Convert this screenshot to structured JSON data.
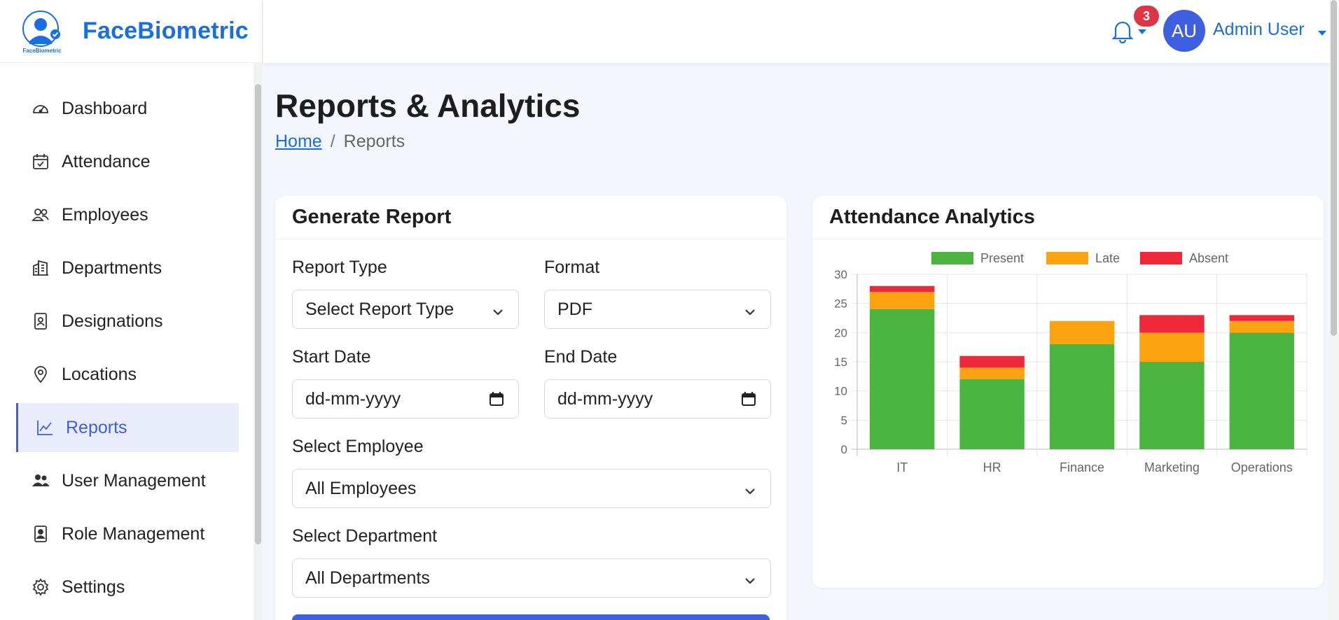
{
  "brand": {
    "name": "FaceBiometric",
    "logo_text": "FaceBiometric"
  },
  "sidebar": {
    "items": [
      {
        "label": "Dashboard",
        "icon": "gauge-icon"
      },
      {
        "label": "Attendance",
        "icon": "calendar-check-icon"
      },
      {
        "label": "Employees",
        "icon": "users-icon"
      },
      {
        "label": "Departments",
        "icon": "building-icon"
      },
      {
        "label": "Designations",
        "icon": "id-badge-icon"
      },
      {
        "label": "Locations",
        "icon": "map-pin-icon"
      },
      {
        "label": "Reports",
        "icon": "chart-line-icon",
        "active": true
      },
      {
        "label": "User Management",
        "icon": "user-group-icon"
      },
      {
        "label": "Role Management",
        "icon": "id-card-icon"
      },
      {
        "label": "Settings",
        "icon": "gear-icon"
      }
    ]
  },
  "header": {
    "notifications_count": "3",
    "avatar_initials": "AU",
    "user_name": "Admin User"
  },
  "page": {
    "title": "Reports & Analytics",
    "breadcrumb_home": "Home",
    "breadcrumb_sep": "/",
    "breadcrumb_current": "Reports"
  },
  "report_form": {
    "title": "Generate Report",
    "report_type_label": "Report Type",
    "report_type_value": "Select Report Type",
    "format_label": "Format",
    "format_value": "PDF",
    "start_date_label": "Start Date",
    "start_date_placeholder": "dd-mm-yyyy",
    "end_date_label": "End Date",
    "end_date_placeholder": "dd-mm-yyyy",
    "employee_label": "Select Employee",
    "employee_value": "All Employees",
    "department_label": "Select Department",
    "department_value": "All Departments"
  },
  "analytics": {
    "title": "Attendance Analytics"
  },
  "colors": {
    "present": "#4cb53f",
    "late": "#fca311",
    "absent": "#ed2939",
    "accent": "#3d5fe0"
  },
  "chart_data": {
    "type": "bar",
    "stacked": true,
    "categories": [
      "IT",
      "HR",
      "Finance",
      "Marketing",
      "Operations"
    ],
    "series": [
      {
        "name": "Present",
        "values": [
          24,
          12,
          18,
          15,
          20
        ]
      },
      {
        "name": "Late",
        "values": [
          3,
          2,
          4,
          5,
          2
        ]
      },
      {
        "name": "Absent",
        "values": [
          1,
          2,
          0,
          3,
          1
        ]
      }
    ],
    "ylim": [
      0,
      30
    ],
    "yticks": [
      0,
      5,
      10,
      15,
      20,
      25,
      30
    ],
    "legend_position": "top",
    "grid": true
  }
}
